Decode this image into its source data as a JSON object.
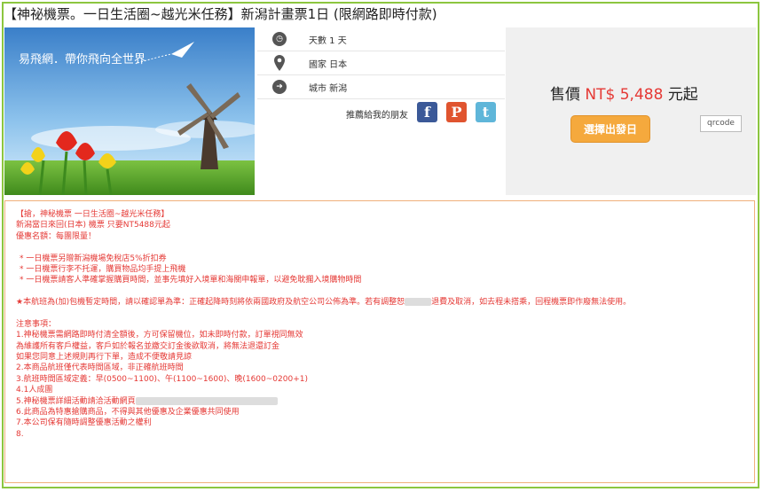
{
  "page": {
    "title": "【神祕機票。一日生活圈~越光米任務】新潟計畫票1日 (限網路即時付款)"
  },
  "hero": {
    "slogan": "易飛網．帶你飛向全世界"
  },
  "info": {
    "days": "天數 1 天",
    "country": "國家 日本",
    "city": "城市 新潟",
    "share_label": "推薦給我的朋友",
    "social": [
      {
        "name": "facebook-icon",
        "glyph": "f"
      },
      {
        "name": "plurk-icon",
        "glyph": "P"
      },
      {
        "name": "twitter-icon",
        "glyph": "t"
      }
    ]
  },
  "price_panel": {
    "prefix": "售價",
    "amount": "NT$ 5,488",
    "suffix": "元起",
    "depart_button": "選擇出發日",
    "qr_alt": "qrcode"
  },
  "description": {
    "lines": [
      "【搶，神秘機票 一日生活圈~越光米任務】",
      "新潟當日來回(日本) 機票 只要NT5488元起",
      "優惠名額：每團限量！",
      "",
      " * 一日機票另贈新潟機場免稅店5%折扣券",
      " * 一日機票行李不托運，購買物品均手提上飛機",
      " * 一日機票請客人準確掌握購買時間，並事先填好入境單和海關申報單，以避免耽擱入境購物時間",
      "",
      "★本航班為(加)包機暫定時間，請以確認單為準：正確起降時刻將依兩國政府及航空公司公佈為準。若有調整恕",
      "",
      "注意事項：",
      "1.神秘機票需網路即時付清全額後，方可保留機位，如未即時付款，訂單視同無效",
      "為維護所有客戶權益，客戶如於報名並繳交訂金後欲取消，將無法退還訂金",
      "如果您同意上述規則再行下單，造成不便敬請見諒",
      "2.本商品航班僅代表時間區域，非正確航班時間",
      "3.航班時間區域定義：早(0500~1100)、午(1100~1600)、晚(1600~0200+1)",
      "4.1人成團",
      "5.神秘機票詳細活動請洽活動網頁",
      "6.此商品為特惠搶購商品，不得與其他優惠及企業優惠共同使用",
      "7.本公司保有隨時調整優惠活動之權利",
      "8."
    ],
    "line9_tail": "退費及取消，如去程未搭乘，回程機票即作廢無法使用。"
  },
  "colors": {
    "accent_border": "#8cc63f",
    "price_red": "#e53935",
    "button_orange": "#f5a93d",
    "desc_text": "#e53935"
  }
}
